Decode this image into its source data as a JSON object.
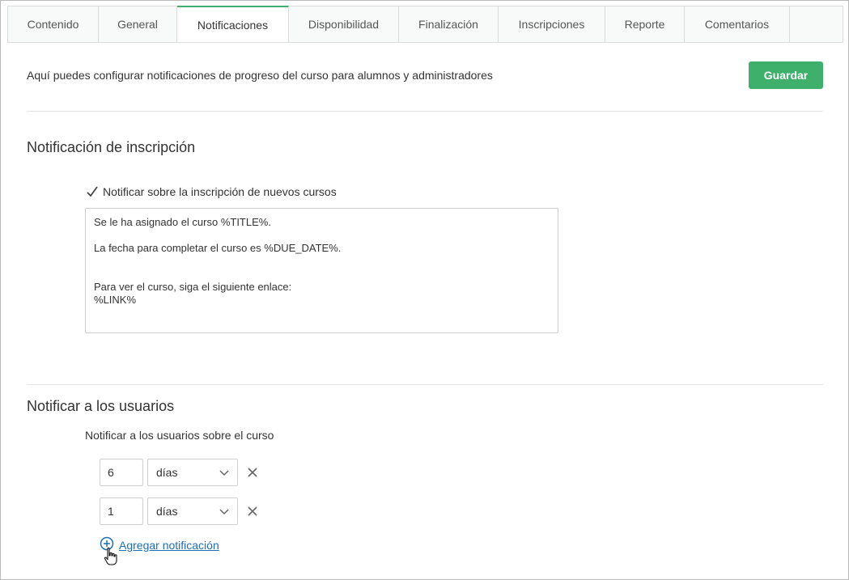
{
  "tabs": [
    {
      "label": "Contenido",
      "active": false
    },
    {
      "label": "General",
      "active": false
    },
    {
      "label": "Notificaciones",
      "active": true
    },
    {
      "label": "Disponibilidad",
      "active": false
    },
    {
      "label": "Finalización",
      "active": false
    },
    {
      "label": "Inscripciones",
      "active": false
    },
    {
      "label": "Reporte",
      "active": false
    },
    {
      "label": "Comentarios",
      "active": false
    }
  ],
  "header": {
    "intro": "Aquí puedes configurar notificaciones de progreso del curso para alumnos y administradores",
    "save_label": "Guardar"
  },
  "enrollment": {
    "title": "Notificación de inscripción",
    "checkbox_label": "Notificar sobre la inscripción de nuevos cursos",
    "checked": true,
    "message_lines": [
      "Se le ha asignado el curso %TITLE%.",
      "La fecha para completar el curso es %DUE_DATE%.",
      "Para ver el curso, siga el siguiente enlace:",
      "%LINK%"
    ]
  },
  "notify_users": {
    "title": "Notificar a los usuarios",
    "label": "Notificar a los usuarios sobre el curso",
    "rows": [
      {
        "value": "6",
        "unit": "días"
      },
      {
        "value": "1",
        "unit": "días"
      }
    ],
    "add_label": "Agregar notificación"
  },
  "colors": {
    "accent": "#3eb06c",
    "link": "#1f6fb5"
  },
  "icons": [
    "checkmark-icon",
    "chevron-down-icon",
    "close-icon",
    "plus-circle-icon",
    "hand-pointer-icon"
  ]
}
